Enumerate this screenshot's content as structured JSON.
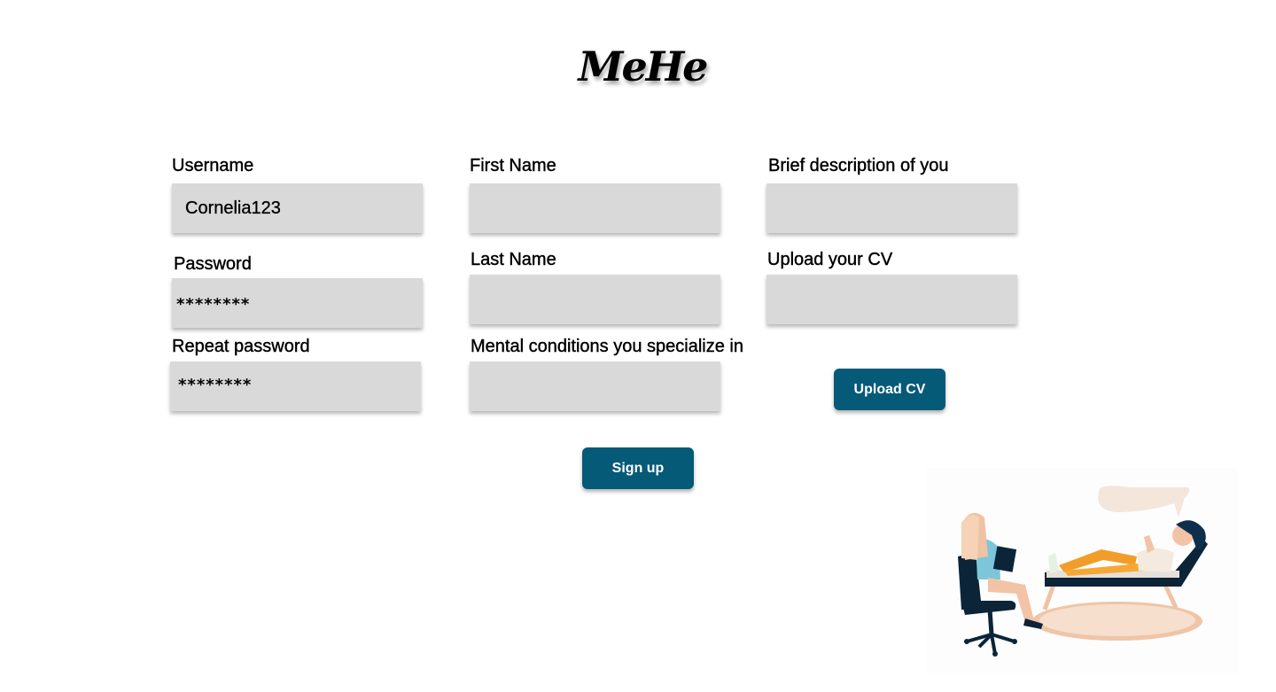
{
  "brand": {
    "logo_text": "MeHe"
  },
  "form": {
    "username": {
      "label": "Username",
      "value": "Cornelia123"
    },
    "password": {
      "label": "Password",
      "value": "********"
    },
    "repeat_password": {
      "label": "Repeat password",
      "value": "********"
    },
    "first_name": {
      "label": "First Name",
      "value": ""
    },
    "last_name": {
      "label": "Last Name",
      "value": ""
    },
    "mental_conditions": {
      "label": "Mental conditions you specialize in",
      "value": ""
    },
    "description": {
      "label": "Brief description of you",
      "value": ""
    },
    "cv": {
      "label": "Upload your CV",
      "value": ""
    }
  },
  "buttons": {
    "upload_cv": "Upload CV",
    "sign_up": "Sign up"
  },
  "colors": {
    "primary_button": "#055a78",
    "field_background": "#d9d9d9"
  },
  "illustration": {
    "icon": "therapy-session-illustration"
  }
}
